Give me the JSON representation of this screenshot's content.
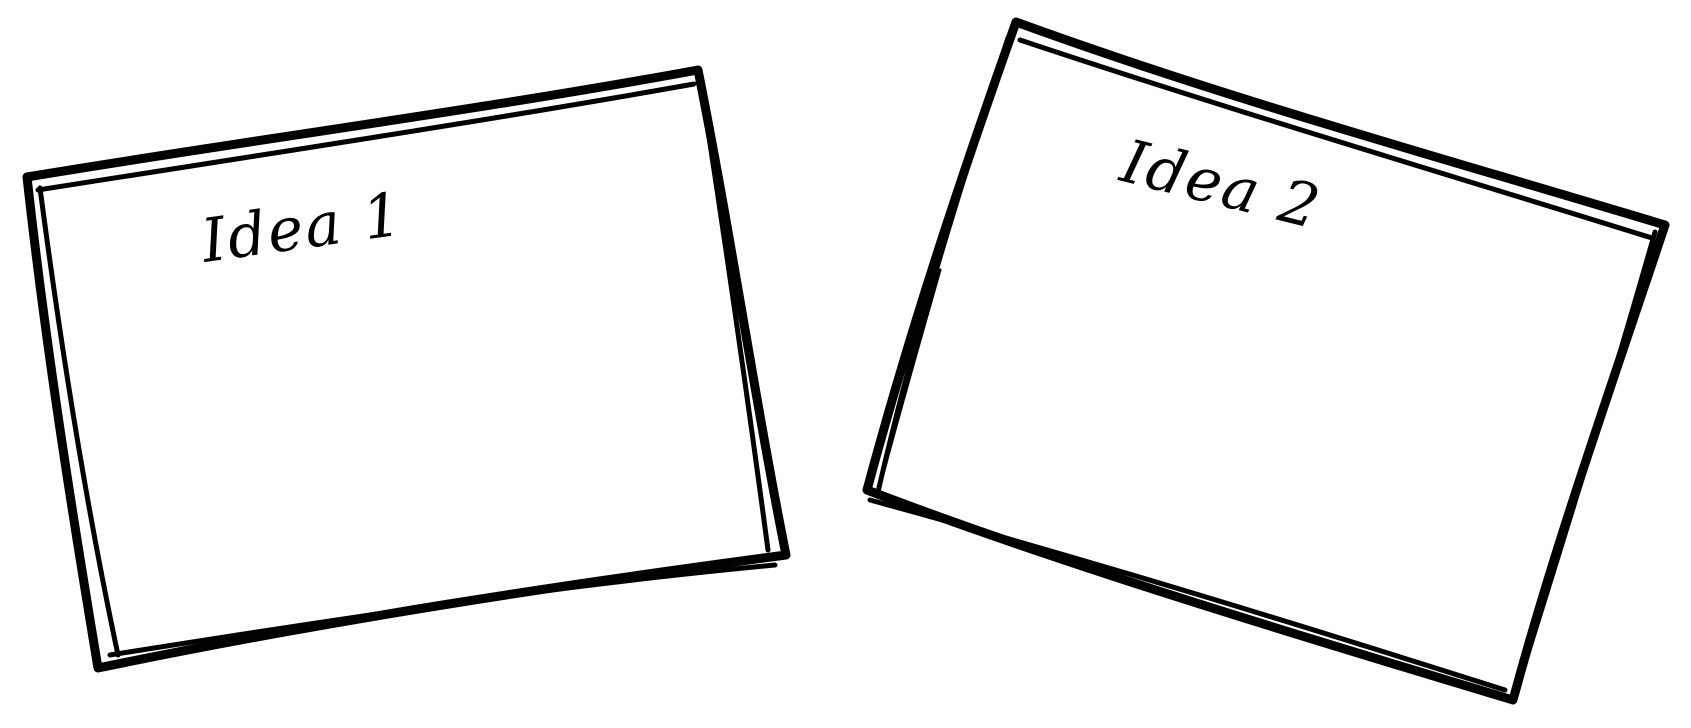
{
  "cards": [
    {
      "id": "idea-1",
      "label": "Idea 1"
    },
    {
      "id": "idea-2",
      "label": "Idea 2"
    }
  ],
  "colors": {
    "background": "#ffffff",
    "stroke": "#000000"
  }
}
